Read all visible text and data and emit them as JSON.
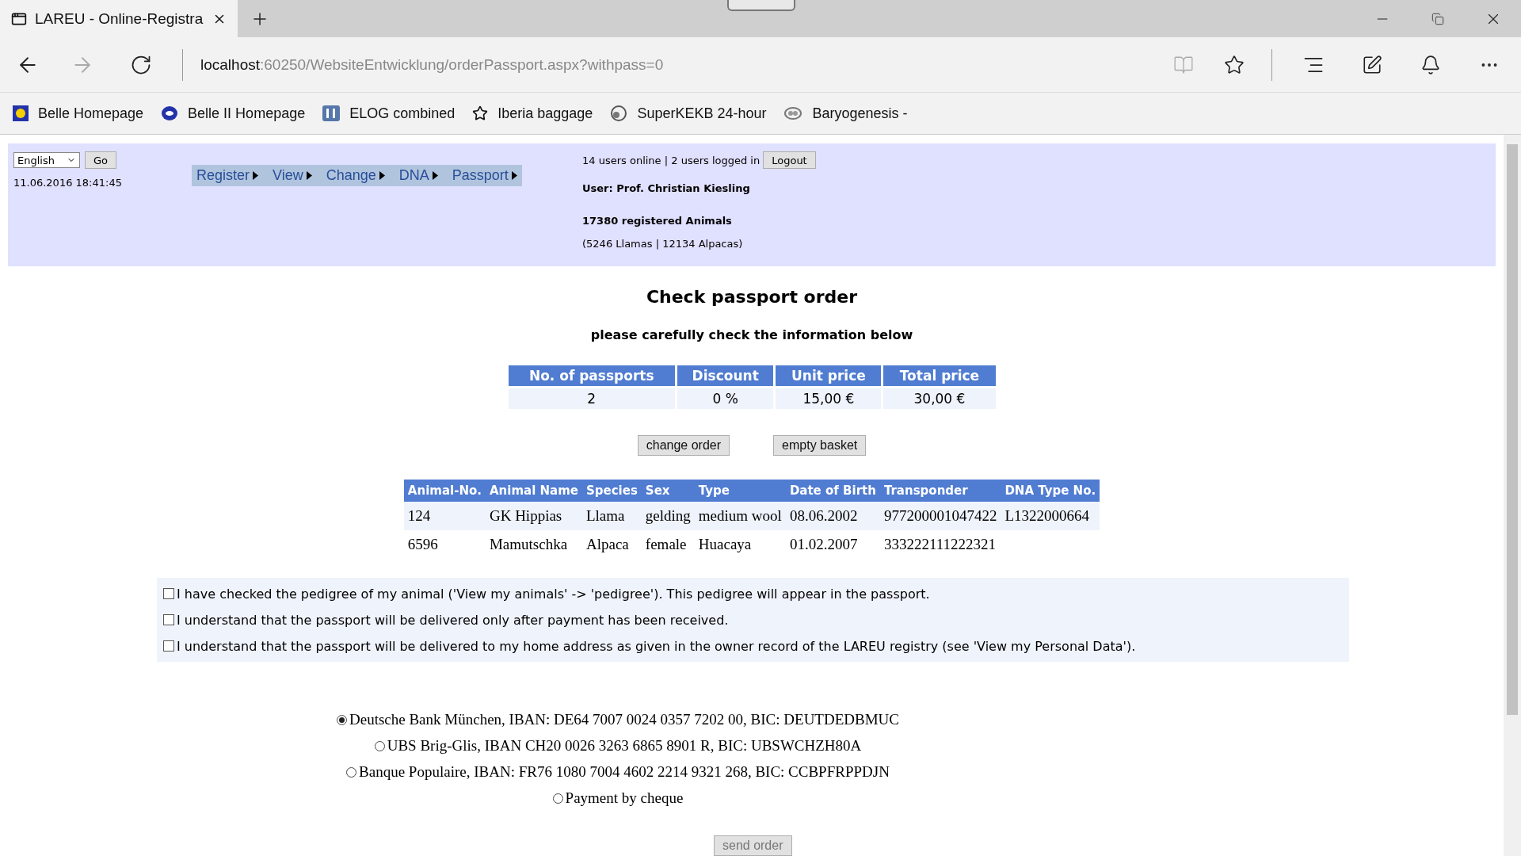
{
  "browser": {
    "tab_title": "LAREU - Online-Registra",
    "url_host": "localhost",
    "url_path": ":60250/WebsiteEntwicklung/orderPassport.aspx?withpass=0",
    "bookmarks": [
      "Belle Homepage",
      "Belle II Homepage",
      "ELOG combined",
      "Iberia baggage",
      "SuperKEKB 24-hour",
      "Baryogenesis -"
    ]
  },
  "header": {
    "language": "English",
    "go_button": "Go",
    "datetime": "11.06.2016 18:41:45",
    "menu": [
      "Register",
      "View",
      "Change",
      "DNA",
      "Passport"
    ],
    "online_status": "14 users online | 2 users logged in",
    "logout_button": "Logout",
    "user": "User: Prof. Christian Kiesling",
    "registered": "17380 registered Animals",
    "breakdown": "(5246 Llamas | 12134 Alpacas)"
  },
  "main": {
    "title": "Check passport order",
    "subtitle": "please carefully check the information below",
    "summary": {
      "columns": [
        "No. of passports",
        "Discount",
        "Unit price",
        "Total price"
      ],
      "row": [
        "2",
        "0 %",
        "15,00 €",
        "30,00 €"
      ]
    },
    "buttons": [
      "change order",
      "empty basket"
    ],
    "animals": {
      "columns": [
        "Animal-No.",
        "Animal Name",
        "Species",
        "Sex",
        "Type",
        "Date of Birth",
        "Transponder",
        "DNA Type No."
      ],
      "rows": [
        [
          "124",
          "GK Hippias",
          "Llama",
          "gelding",
          "medium wool",
          "08.06.2002",
          "977200001047422",
          "L1322000664"
        ],
        [
          "6596",
          "Mamutschka",
          "Alpaca",
          "female",
          "Huacaya",
          "01.02.2007",
          "333222111222321",
          ""
        ]
      ]
    },
    "confirmations": [
      {
        "label": "I have checked the pedigree of my animal ('View my animals' -> 'pedigree'). This pedigree will appear in the passport.",
        "checked": false
      },
      {
        "label": "I understand that the passport will be delivered only after payment has been received.",
        "checked": false
      },
      {
        "label": "I understand that the passport will be delivered to my home address as given in the owner record of the LAREU registry (see 'View my Personal Data').",
        "checked": false
      }
    ],
    "payment_options": [
      {
        "label": "Deutsche Bank München, IBAN: DE64 7007 0024 0357 7202 00, BIC: DEUTDEDBMUC",
        "selected": true
      },
      {
        "label": "UBS Brig-Glis, IBAN CH20 0026 3263 6865 8901 R, BIC: UBSWCHZH80A",
        "selected": false
      },
      {
        "label": "Banque Populaire, IBAN: FR76 1080 7004 4602 2214 9321 268, BIC: CCBPFRPPDJN",
        "selected": false
      },
      {
        "label": "Payment by cheque",
        "selected": false
      }
    ],
    "send_button": {
      "label": "send order",
      "disabled": true
    }
  }
}
